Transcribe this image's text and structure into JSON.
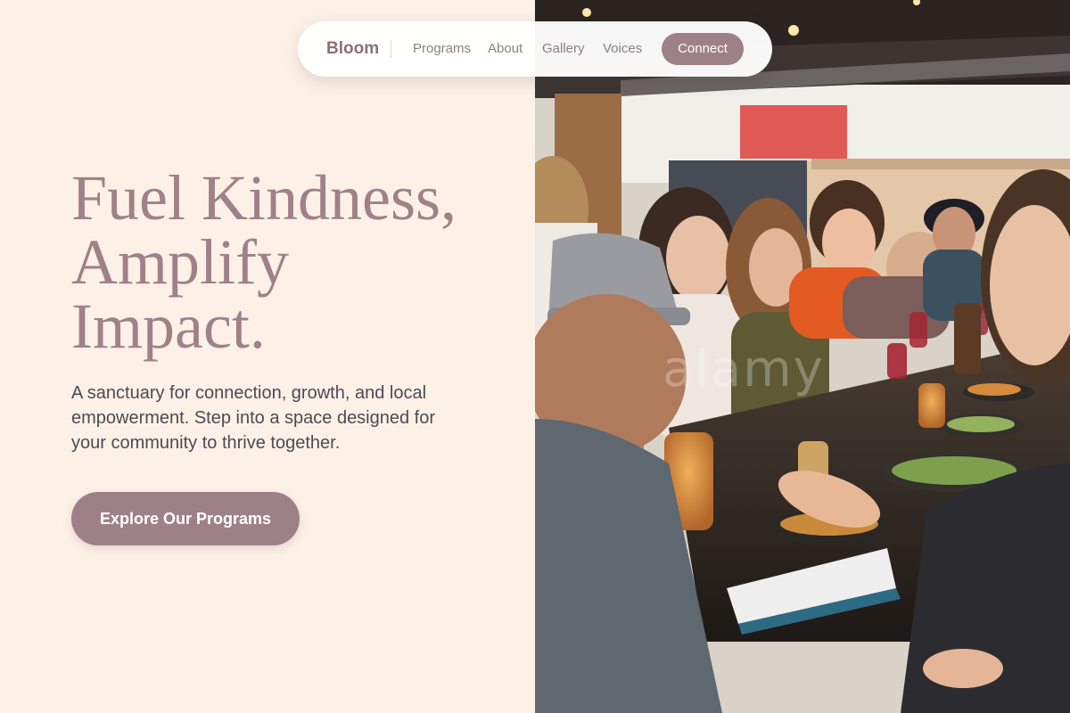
{
  "navbar": {
    "brand": "Bloom",
    "links": [
      {
        "label": "Programs"
      },
      {
        "label": "About"
      },
      {
        "label": "Gallery"
      },
      {
        "label": "Voices"
      }
    ],
    "cta_label": "Connect"
  },
  "hero": {
    "title_lines": [
      "Fuel Kindness,",
      "Amplify",
      "Impact."
    ],
    "subtitle": "A sanctuary for connection, growth, and local empowerment. Step into a space designed for your community to thrive together.",
    "cta_label": "Explore Our Programs"
  },
  "photo": {
    "subject": "people-dining-at-long-table",
    "watermark": "alamy"
  },
  "colors": {
    "background": "#fdf1e7",
    "accent": "#9e8088",
    "title": "#a08187",
    "body_text": "#4a4a55",
    "nav_text": "#8d7f83"
  }
}
